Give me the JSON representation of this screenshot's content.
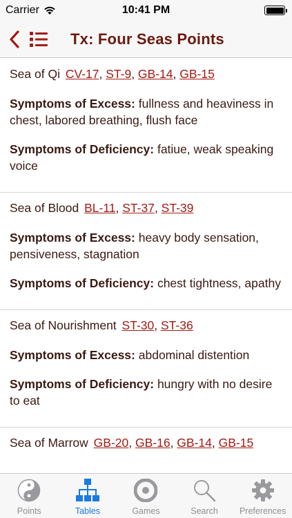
{
  "status_bar": {
    "carrier": "Carrier",
    "time": "10:41 PM"
  },
  "nav": {
    "title": "Tx: Four Seas Points"
  },
  "sections": [
    {
      "name": "Sea of Qi",
      "points": [
        "CV-17",
        "ST-9",
        "GB-14",
        "GB-15"
      ],
      "excess_label": "Symptoms of Excess:",
      "excess_text": "fullness and heaviness in chest, labored breathing, flush face",
      "deficiency_label": "Symptoms of Deficiency:",
      "deficiency_text": "fatiue, weak speaking voice"
    },
    {
      "name": "Sea of Blood",
      "points": [
        "BL-11",
        "ST-37",
        "ST-39"
      ],
      "excess_label": "Symptoms of Excess:",
      "excess_text": "heavy body sensation, pensiveness, stagnation",
      "deficiency_label": "Symptoms of Deficiency:",
      "deficiency_text": "chest tightness, apathy"
    },
    {
      "name": "Sea of Nourishment",
      "points": [
        "ST-30",
        "ST-36"
      ],
      "excess_label": "Symptoms of Excess:",
      "excess_text": "abdominal distention",
      "deficiency_label": "Symptoms of Deficiency:",
      "deficiency_text": "hungry with no desire to eat"
    },
    {
      "name": "Sea of Marrow",
      "points": [
        "GB-20",
        "GB-16",
        "GB-14",
        "GB-15"
      ]
    }
  ],
  "tabs": [
    {
      "label": "Points",
      "icon": "yin-yang-icon"
    },
    {
      "label": "Tables",
      "icon": "hierarchy-icon"
    },
    {
      "label": "Games",
      "icon": "target-icon"
    },
    {
      "label": "Search",
      "icon": "search-icon"
    },
    {
      "label": "Preferences",
      "icon": "gear-icon"
    }
  ],
  "active_tab": "Tables",
  "colors": {
    "accent": "#a31b14",
    "title": "#6b1a0e",
    "tab_active": "#1a7be0",
    "tab_inactive": "#8e8e93"
  }
}
